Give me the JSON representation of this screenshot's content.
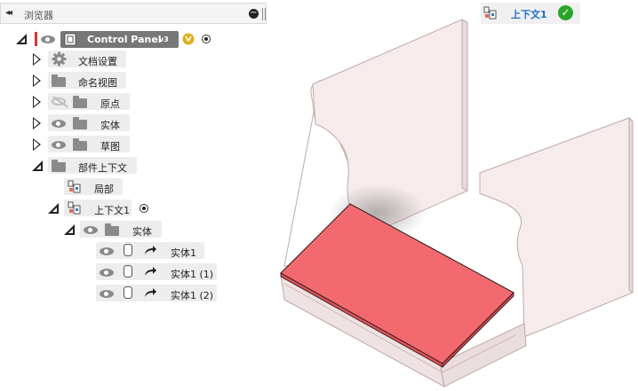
{
  "browser": {
    "title": "浏览器",
    "collapse_glyph": "◂◂",
    "minus_glyph": "−"
  },
  "tree": {
    "root": {
      "label": "Control Panel",
      "version": "v3"
    },
    "items": [
      {
        "label": "文档设置",
        "icon": "gear-icon"
      },
      {
        "label": "命名视图",
        "icon": "folder-icon"
      },
      {
        "label": "原点",
        "icon": "folder-icon",
        "visibility": "hidden"
      },
      {
        "label": "实体",
        "icon": "folder-icon",
        "visibility": "visible"
      },
      {
        "label": "草图",
        "icon": "folder-icon",
        "visibility": "visible"
      },
      {
        "label": "部件上下文",
        "icon": "folder-icon"
      },
      {
        "label": "局部",
        "icon": "component-icon"
      },
      {
        "label": "上下文1",
        "icon": "component-icon"
      },
      {
        "label": "实体",
        "icon": "folder-icon",
        "visibility": "visible"
      },
      {
        "label": "实体1",
        "icon": "body-icon"
      },
      {
        "label": "实体1 (1)",
        "icon": "body-icon"
      },
      {
        "label": "实体1 (2)",
        "icon": "body-icon"
      }
    ]
  },
  "context_badge": {
    "label": "上下文1",
    "status": "check-icon"
  },
  "colors": {
    "selected_face": "#f26a6f",
    "panel_face": "#f7ecec",
    "accent_blue": "#1f6fc5",
    "status_green": "#2aa52a"
  }
}
